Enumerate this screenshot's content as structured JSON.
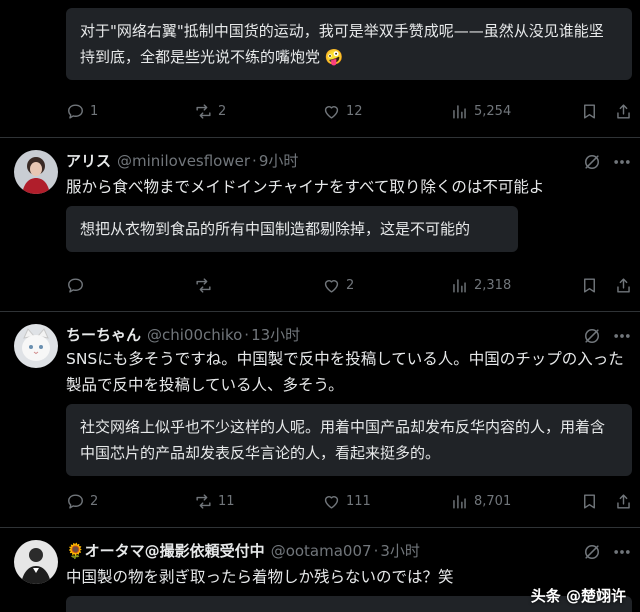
{
  "posts": [
    {
      "translation": "对于\"网络右翼\"抵制中国货的运动，我可是举双手赞成呢——虽然从没见谁能坚持到底，全都是些光说不练的嘴炮党 🤪",
      "stats": {
        "replies": "1",
        "reposts": "2",
        "likes": "12",
        "views": "5,254"
      }
    },
    {
      "name": "アリス",
      "handle": "@minilovesflower",
      "dot": "·",
      "time": "9小时",
      "text": "服から食べ物までメイドインチャイナをすべて取り除くのは不可能よ",
      "translation": "想把从衣物到食品的所有中国制造都剔除掉，这是不可能的",
      "stats": {
        "replies": "",
        "reposts": "",
        "likes": "2",
        "views": "2,318"
      }
    },
    {
      "name": "ちーちゃん",
      "handle": "@chi00chiko",
      "dot": "·",
      "time": "13小时",
      "text": "SNSにも多そうですね。中国製で反中を投稿している人。中国のチップの入った製品で反中を投稿している人、多そう。",
      "translation": "社交网络上似乎也不少这样的人呢。用着中国产品却发布反华内容的人，用着含中国芯片的产品却发表反华言论的人，看起来挺多的。",
      "stats": {
        "replies": "2",
        "reposts": "11",
        "likes": "111",
        "views": "8,701"
      }
    },
    {
      "name": "🌻オータマ@撮影依頼受付中",
      "handle": "@ootama007",
      "dot": "·",
      "time": "3小时",
      "text": "中国製の物を剥ぎ取ったら着物しか残らないのでは？笑"
    }
  ],
  "watermark": "头条 @楚翊许",
  "icons": {
    "reply": "speech-bubble-icon",
    "repost": "repost-arrows-icon",
    "like": "heart-icon",
    "views": "bar-chart-icon",
    "bookmark": "bookmark-icon",
    "share": "share-upload-icon",
    "grok": "grok-slash-circle-icon",
    "more": "more-dots-icon"
  }
}
